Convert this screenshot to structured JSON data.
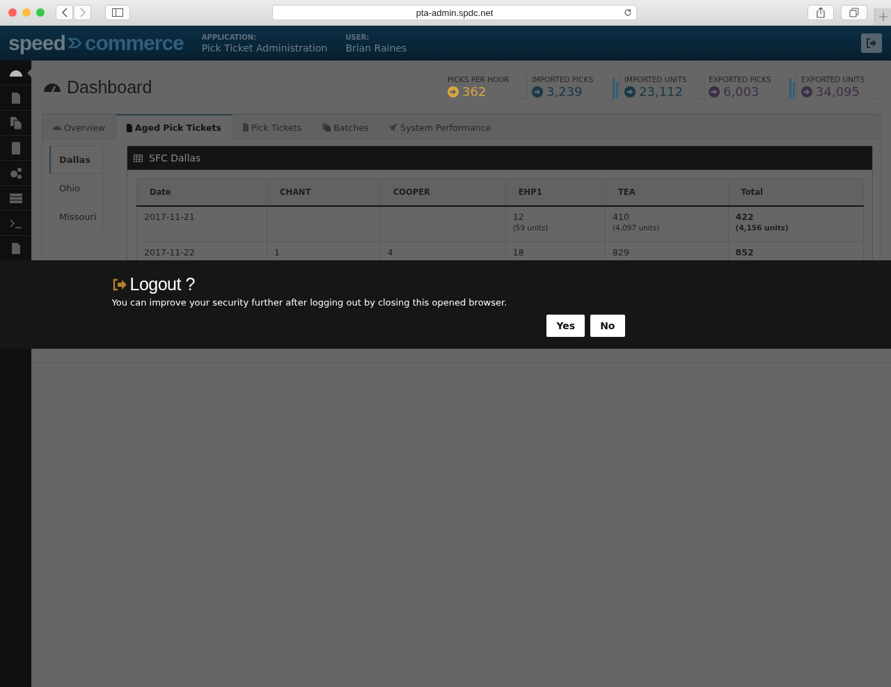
{
  "browser": {
    "url": "pta-admin.spdc.net"
  },
  "header": {
    "logo_part_1": "speed",
    "logo_part_2": "commerce",
    "application_label": "APPLICATION:",
    "application": "Pick Ticket Administration",
    "user_label": "USER:",
    "user": "Brian Raines"
  },
  "sidebar": {
    "items": [
      {
        "selected": true
      },
      {
        "selected": false
      },
      {
        "selected": false
      },
      {
        "selected": false
      },
      {
        "selected": false
      },
      {
        "selected": false
      },
      {
        "selected": false
      },
      {
        "selected": false
      }
    ]
  },
  "page": {
    "title": "Dashboard"
  },
  "stats": [
    {
      "label": "PICKS PER HOUR",
      "value": "362",
      "color": "#d9a640"
    },
    {
      "label": "IMPORTED PICKS",
      "value": "3,239",
      "color": "#173848"
    },
    {
      "label": "IMPORTED UNITS",
      "value": "23,112",
      "color": "#173848"
    },
    {
      "label": "EXPORTED PICKS",
      "value": "6,003",
      "color": "#3d2e48"
    },
    {
      "label": "EXPORTED UNITS",
      "value": "34,095",
      "color": "#3d2e48"
    }
  ],
  "tabs": [
    {
      "label": "Overview",
      "selected": false
    },
    {
      "label": "Aged Pick Tickets",
      "selected": true
    },
    {
      "label": "Pick Tickets",
      "selected": false
    },
    {
      "label": "Batches",
      "selected": false
    },
    {
      "label": "System Performance",
      "selected": false
    }
  ],
  "locations": [
    {
      "label": "Dallas",
      "selected": true
    },
    {
      "label": "Ohio",
      "selected": false
    },
    {
      "label": "Missouri",
      "selected": false
    }
  ],
  "panel": {
    "title": "SFC Dallas",
    "table": {
      "columns": [
        {
          "label": "Date",
          "kind": "plain"
        },
        {
          "label": "CHANT",
          "kind": "plain"
        },
        {
          "label": "COOPER",
          "kind": "plain"
        },
        {
          "label": "EHP1",
          "kind": "plain"
        },
        {
          "label": "TEA",
          "kind": "plain"
        },
        {
          "label": "Total",
          "kind": "total"
        }
      ],
      "rows": [
        {
          "cells": [
            {
              "value": "2017-11-21"
            },
            {},
            {},
            {
              "value": "12",
              "units": "(59 units)"
            },
            {
              "value": "410",
              "units": "(4,097 units)"
            },
            {
              "value": "422",
              "units": "(4,156 units)"
            }
          ]
        },
        {
          "cells": [
            {
              "value": "2017-11-22"
            },
            {
              "value": "1"
            },
            {
              "value": "4"
            },
            {
              "value": "18"
            },
            {
              "value": "829"
            },
            {
              "value": "852"
            }
          ]
        }
      ]
    }
  },
  "dialog": {
    "title": "Logout ?",
    "message": "You can improve your security further after logging out by closing this opened browser.",
    "buttons": [
      "Yes",
      "No"
    ]
  }
}
